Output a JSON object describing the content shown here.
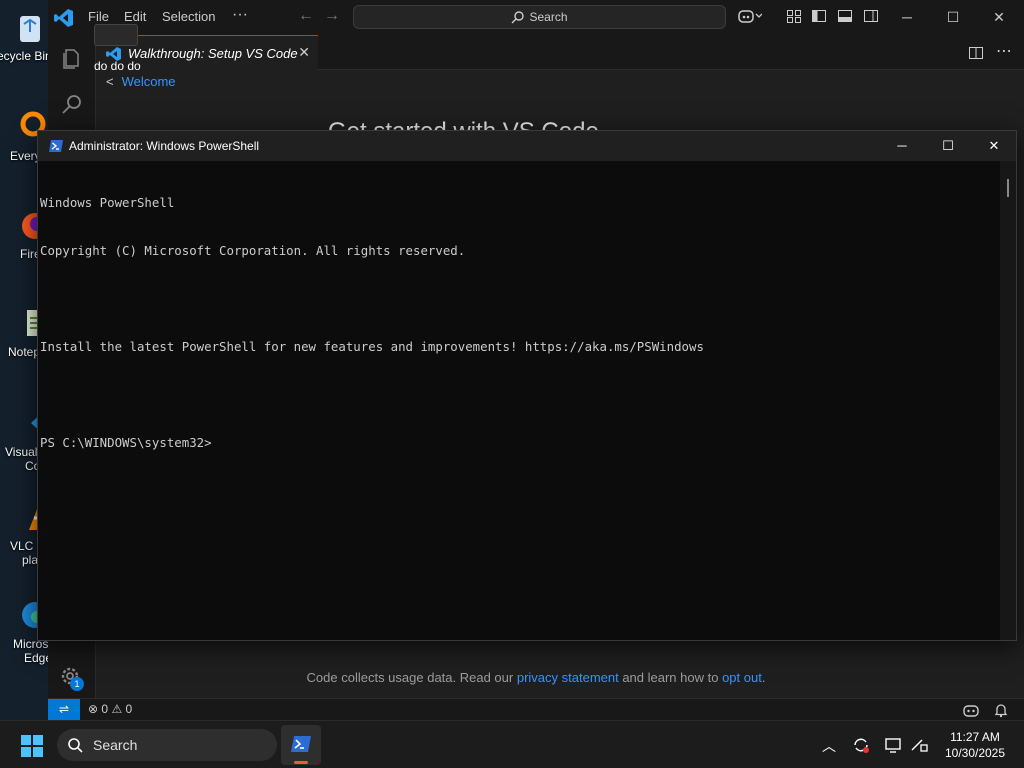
{
  "desktop": {
    "icons": [
      {
        "label": "Recycle Bin"
      },
      {
        "label": "Every"
      },
      {
        "label": "Fire"
      },
      {
        "label": "Notep"
      },
      {
        "label": "Visual"
      },
      {
        "label": "Co"
      },
      {
        "label": "VLC m"
      },
      {
        "label": "pla"
      },
      {
        "label": "Microsoft"
      },
      {
        "label": "Edge"
      }
    ]
  },
  "vscode": {
    "menu": {
      "file": "File",
      "edit": "Edit",
      "selection": "Selection",
      "more": "···"
    },
    "search_label": "Search",
    "hover_tooltip": "do do do",
    "tab": {
      "label": "Walkthrough: Setup VS Code",
      "close": "✕"
    },
    "breadcrumb_link": "Welcome",
    "page_heading": "Get started with VS Code",
    "privacy": {
      "prefix": "Code collects usage data. Read our ",
      "link1": "privacy statement",
      "middle": " and learn how to ",
      "link2": "opt out",
      "suffix": "."
    },
    "status": {
      "errors": "0",
      "warnings": "0"
    },
    "accounts_badge": "1"
  },
  "powershell": {
    "title": "Administrator: Windows PowerShell",
    "lines": [
      "Windows PowerShell",
      "Copyright (C) Microsoft Corporation. All rights reserved.",
      "",
      "Install the latest PowerShell for new features and improvements! https://aka.ms/PSWindows",
      "",
      "PS C:\\WINDOWS\\system32> "
    ]
  },
  "taskbar": {
    "search_label": "Search",
    "time": "11:27 AM",
    "date": "10/30/2025"
  },
  "colors": {
    "accent": "#0078d4",
    "link": "#3794ff",
    "ps_background": "#0c0c0c"
  }
}
